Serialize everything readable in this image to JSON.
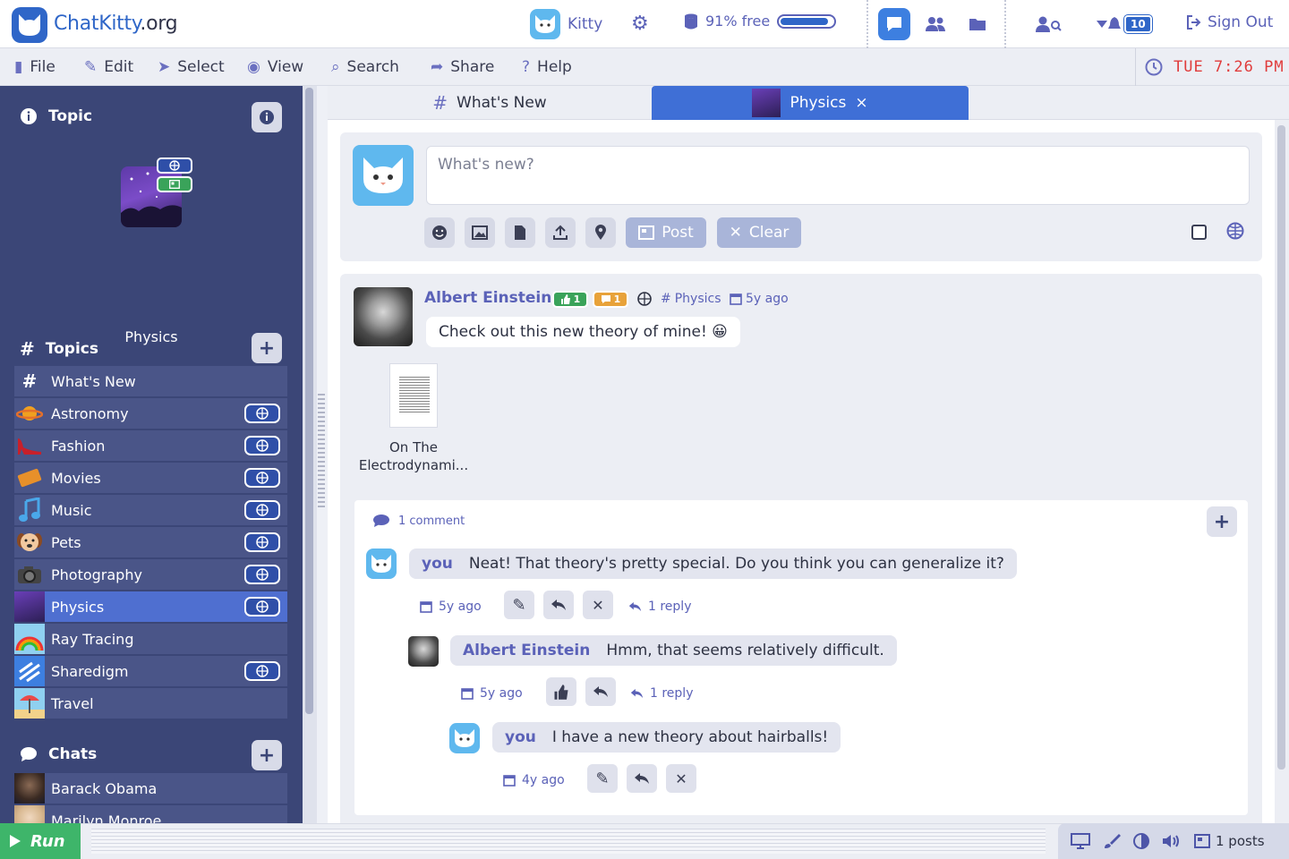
{
  "app": {
    "name": "ChatKitty",
    "tld": ".org"
  },
  "topbar": {
    "username": "Kitty",
    "storage": {
      "label": "91% free",
      "free_fraction": 0.91
    },
    "notifications": "10",
    "sign_out": "Sign Out"
  },
  "menu": {
    "file": "File",
    "edit": "Edit",
    "select": "Select",
    "view": "View",
    "search": "Search",
    "share": "Share",
    "help": "Help"
  },
  "clock": "TUE 7:26 PM",
  "sidebar": {
    "topic_heading": "Topic",
    "current_topic": "Physics",
    "topics_heading": "Topics",
    "topics": [
      {
        "label": "What's New",
        "icon": "hash-icon",
        "shared": false
      },
      {
        "label": "Astronomy",
        "icon": "planet-icon",
        "shared": true
      },
      {
        "label": "Fashion",
        "icon": "shoe-icon",
        "shared": true
      },
      {
        "label": "Movies",
        "icon": "ticket-icon",
        "shared": true
      },
      {
        "label": "Music",
        "icon": "note-icon",
        "shared": true
      },
      {
        "label": "Pets",
        "icon": "dog-icon",
        "shared": true
      },
      {
        "label": "Photography",
        "icon": "camera-icon",
        "shared": true
      },
      {
        "label": "Physics",
        "icon": "galaxy-icon",
        "shared": true,
        "selected": true
      },
      {
        "label": "Ray Tracing",
        "icon": "rainbow-icon",
        "shared": false
      },
      {
        "label": "Sharedigm",
        "icon": "sharedigm-icon",
        "shared": true
      },
      {
        "label": "Travel",
        "icon": "beach-icon",
        "shared": false
      }
    ],
    "chats_heading": "Chats",
    "chats": [
      "Barack Obama",
      "Marilyn Monroe"
    ]
  },
  "tabs": [
    {
      "label": "What's New",
      "icon": "hash-icon",
      "active": false
    },
    {
      "label": "Physics",
      "icon": "galaxy-icon",
      "active": true,
      "close": "×"
    }
  ],
  "composer": {
    "placeholder": "What's new?",
    "post": "Post",
    "clear": "Clear"
  },
  "post": {
    "author": "Albert Einstein",
    "likes": "1",
    "comments_count": "1",
    "topic": "Physics",
    "when": "5y ago",
    "message": "Check out this new theory of mine! 😀",
    "attachment": {
      "name": "On The Electrodynami..."
    }
  },
  "comments": {
    "label": "1 comment",
    "items": [
      {
        "who": "you",
        "text": "Neat! That theory's pretty special. Do you think you can generalize it?",
        "when": "5y ago",
        "replies": "1 reply"
      },
      {
        "who": "Albert Einstein",
        "text": "Hmm, that seems relatively difficult.",
        "when": "5y ago",
        "replies": "1 reply"
      },
      {
        "who": "you",
        "text": "I have a new theory about hairballs!",
        "when": "4y ago"
      }
    ]
  },
  "statusbar": {
    "run": "Run",
    "posts": "1 posts"
  },
  "colors": {
    "brand": "#2f66c8",
    "sidebar": "#3b4677",
    "accent": "#5b62b8",
    "clock": "#e03c3c",
    "run": "#3eb56a"
  }
}
